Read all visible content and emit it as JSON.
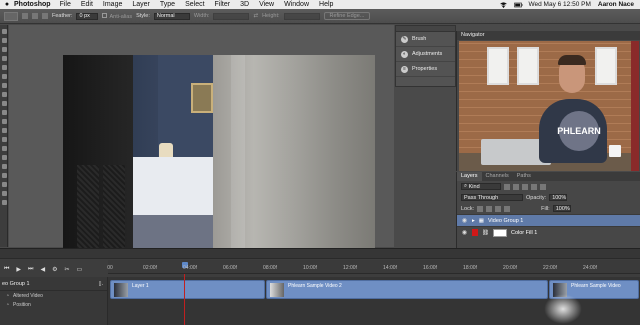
{
  "menubar": {
    "app_name": "Photoshop",
    "menus": [
      "File",
      "Edit",
      "Image",
      "Layer",
      "Type",
      "Select",
      "Filter",
      "3D",
      "View",
      "Window",
      "Help"
    ],
    "datetime": "Wed May 6  12:50 PM",
    "user": "Aaron Nace"
  },
  "options_bar": {
    "feather_label": "Feather:",
    "feather_value": "0 px",
    "antialias_label": "Anti-alias",
    "style_label": "Style:",
    "style_value": "Normal",
    "width_label": "Width:",
    "height_label": "Height:",
    "refine_edge_label": "Refine Edge..."
  },
  "dock_panels": {
    "items": [
      {
        "label": "Brush"
      },
      {
        "label": "Adjustments"
      },
      {
        "label": "Properties"
      }
    ]
  },
  "navigator": {
    "tab_label": "Navigator",
    "badge_text": "PHLEARN"
  },
  "layers_panel": {
    "tabs": [
      "Layers",
      "Channels",
      "Paths"
    ],
    "kind_label": "Kind",
    "blend_mode": "Pass Through",
    "opacity_label": "Opacity:",
    "opacity_value": "100%",
    "lock_label": "Lock:",
    "fill_label": "Fill:",
    "fill_value": "100%",
    "layers": [
      {
        "name": "Video Group 1"
      },
      {
        "name": "Color Fill 1"
      }
    ]
  },
  "timeline": {
    "ruler_ticks": [
      "00",
      "02:00f",
      "04:00f",
      "06:00f",
      "08:00f",
      "10:00f",
      "12:00f",
      "14:00f",
      "16:00f",
      "18:00f",
      "20:00f",
      "22:00f",
      "24:00f"
    ],
    "track_name": "eo Group 1",
    "sub_rows": [
      "Altered Video",
      "Position"
    ],
    "clips": [
      "Layer 1",
      "Phlearn Sample Video 2",
      "Phlearn Sample Video"
    ]
  }
}
